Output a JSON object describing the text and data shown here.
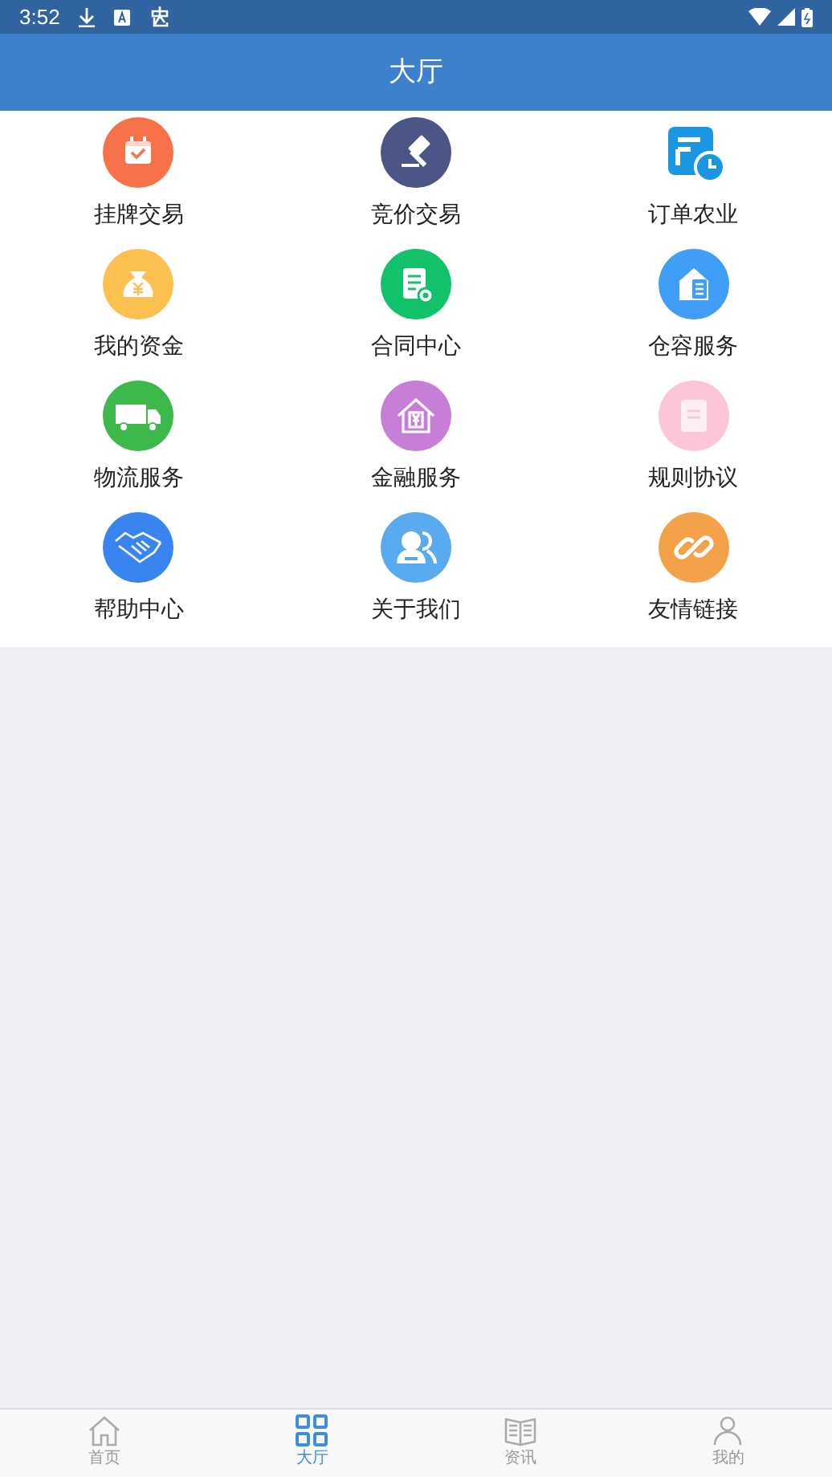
{
  "status_bar": {
    "time": "3:52"
  },
  "header": {
    "title": "大厅"
  },
  "grid": [
    {
      "label": "挂牌交易",
      "kind": "calendar",
      "color": "#f7714b"
    },
    {
      "label": "竞价交易",
      "kind": "gavel",
      "color": "#4b5687"
    },
    {
      "label": "订单农业",
      "kind": "order",
      "color": "#1b96e0"
    },
    {
      "label": "我的资金",
      "kind": "moneybag",
      "color": "#fbc04f"
    },
    {
      "label": "合同中心",
      "kind": "contract",
      "color": "#12c26b"
    },
    {
      "label": "仓容服务",
      "kind": "warehouse",
      "color": "#419ef7"
    },
    {
      "label": "物流服务",
      "kind": "truck",
      "color": "#3cb94a"
    },
    {
      "label": "金融服务",
      "kind": "finance",
      "color": "#c77ed6"
    },
    {
      "label": "规则协议",
      "kind": "document",
      "color": "#fcc6d9"
    },
    {
      "label": "帮助中心",
      "kind": "handshake",
      "color": "#3a84ef"
    },
    {
      "label": "关于我们",
      "kind": "people",
      "color": "#5aaaf0"
    },
    {
      "label": "友情链接",
      "kind": "link",
      "color": "#f4a24a"
    }
  ],
  "tab_bar": [
    {
      "label": "首页",
      "kind": "home",
      "selected": false
    },
    {
      "label": "大厅",
      "kind": "grid",
      "selected": true
    },
    {
      "label": "资讯",
      "kind": "book",
      "selected": false
    },
    {
      "label": "我的",
      "kind": "person",
      "selected": false
    }
  ]
}
